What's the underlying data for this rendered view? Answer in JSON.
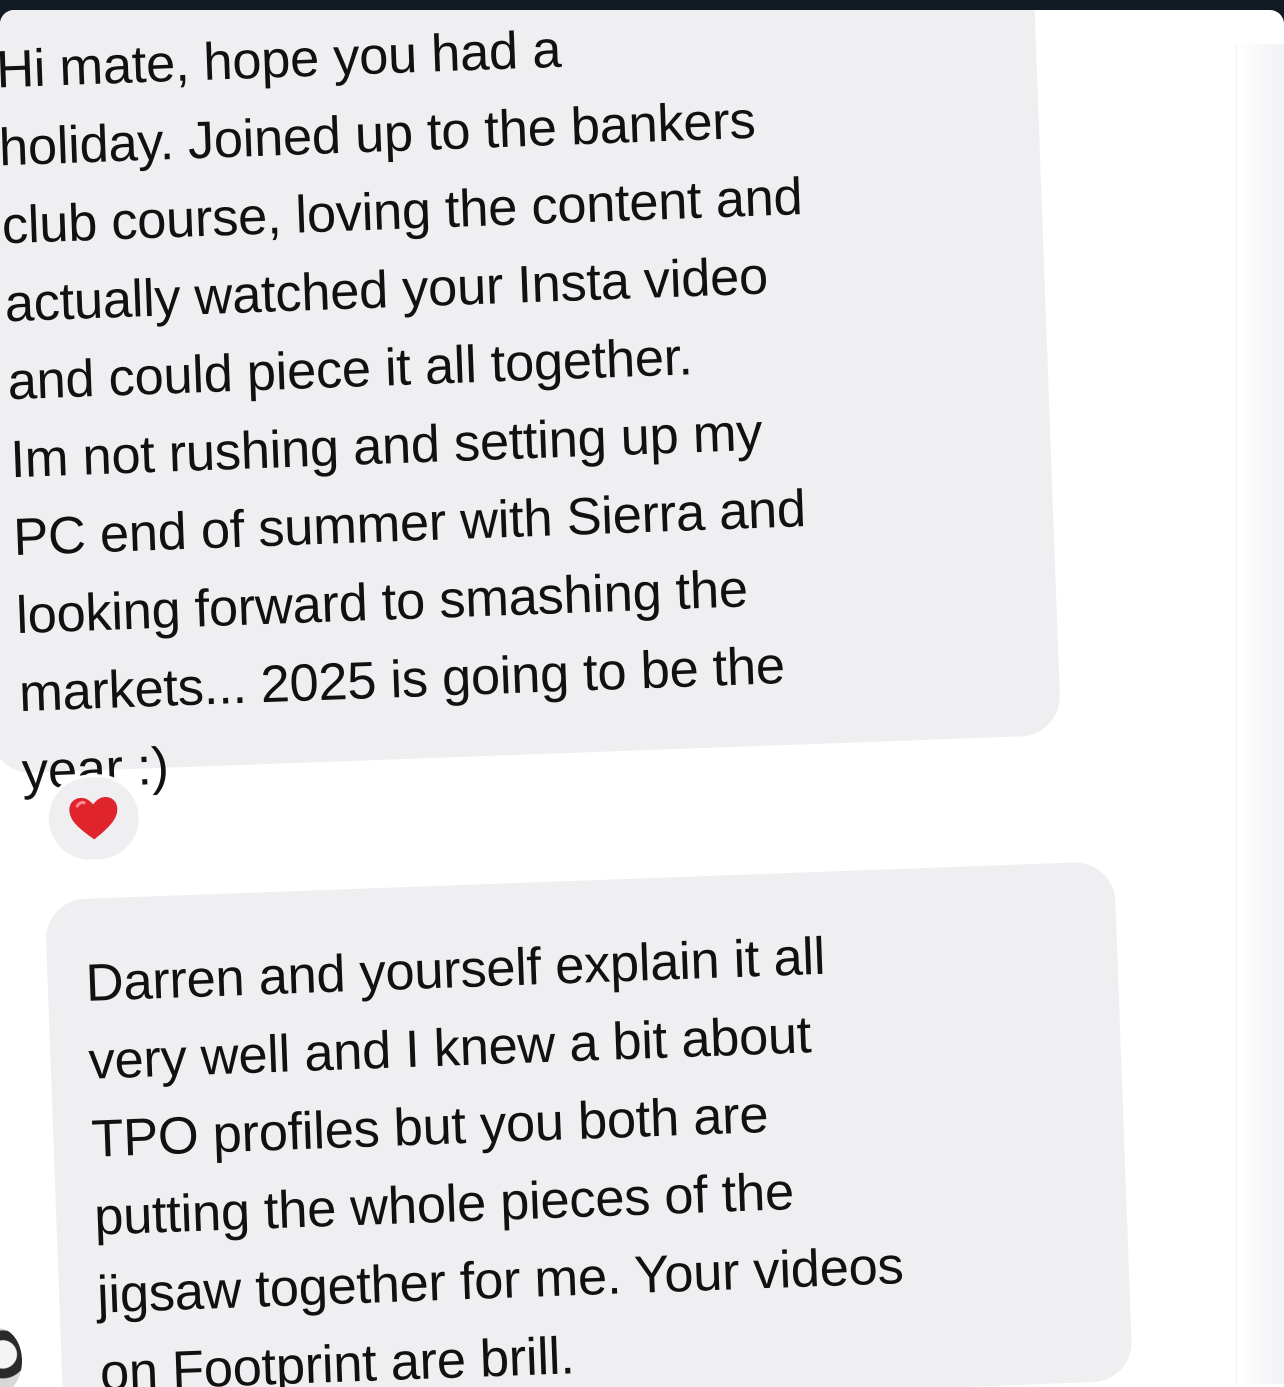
{
  "messages": [
    {
      "lines": [
        "Hi mate, hope you had a",
        "holiday. Joined up to the bankers",
        "club course, loving the content and",
        "actually watched your Insta video",
        "and could piece it all together.",
        "Im not rushing and setting up my",
        "PC end of summer with Sierra and",
        "looking forward to smashing the",
        "markets... 2025 is going to be the",
        "year :)"
      ],
      "reaction": {
        "icon": "red-heart-icon",
        "color": "#e0242b"
      }
    },
    {
      "lines": [
        "Darren and yourself explain it all",
        "very well and I knew a bit about",
        "TPO profiles but you both are",
        "putting the whole pieces of the",
        "jigsaw together for me. Your videos",
        "on Footprint are brill."
      ]
    }
  ],
  "colors": {
    "bubble": "#efeff2",
    "text": "#111111",
    "top_bar": "#121a23",
    "accent_purple": "#9a2bd0"
  }
}
